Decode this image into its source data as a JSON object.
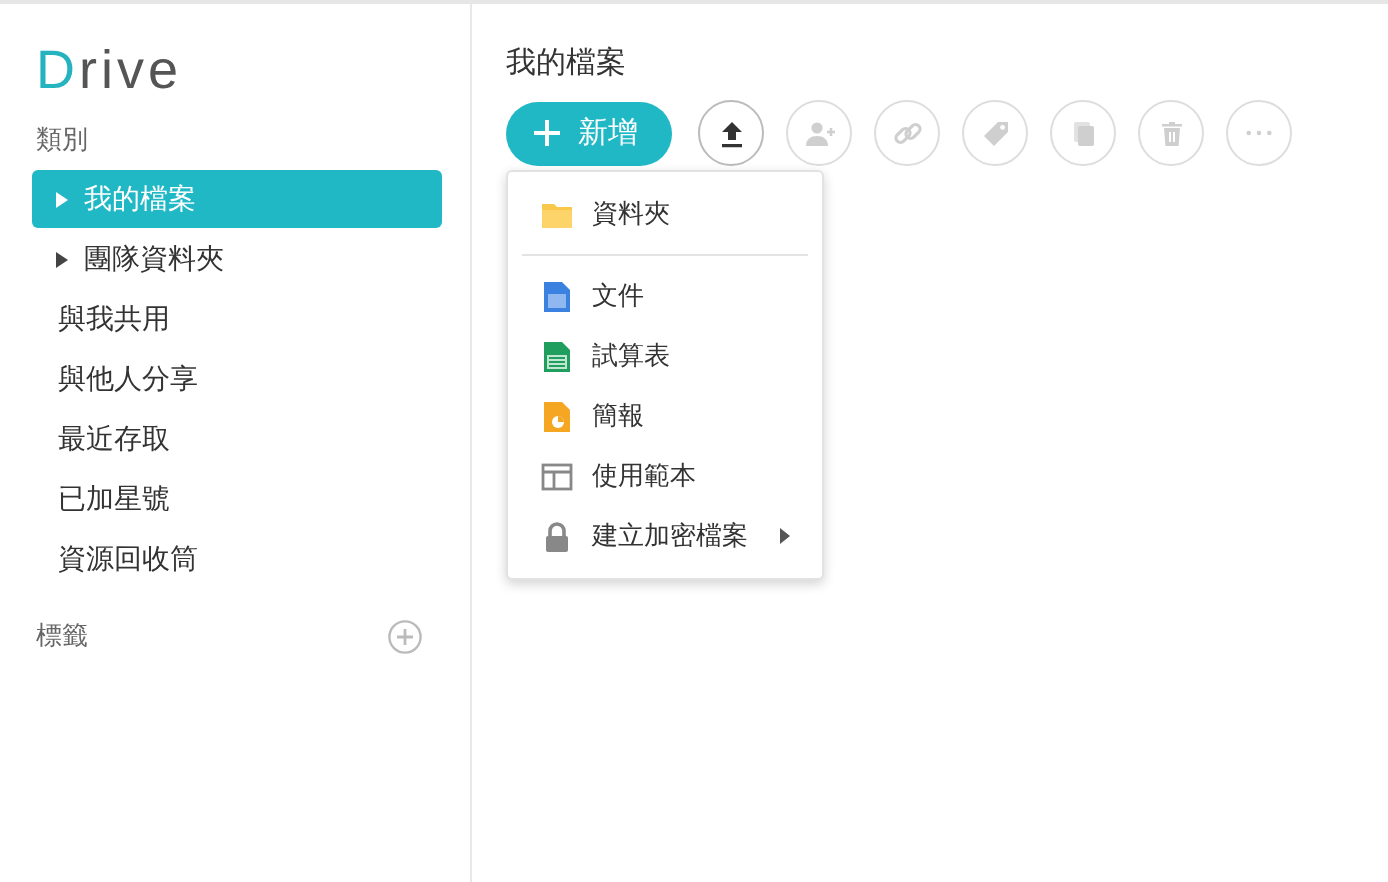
{
  "logo": {
    "text": "Drive"
  },
  "sidebar": {
    "heading": "類別",
    "items": [
      {
        "label": "我的檔案",
        "kind": "expandable",
        "selected": true
      },
      {
        "label": "團隊資料夾",
        "kind": "expandable",
        "selected": false
      },
      {
        "label": "與我共用",
        "kind": "plain",
        "selected": false
      },
      {
        "label": "與他人分享",
        "kind": "plain",
        "selected": false
      },
      {
        "label": "最近存取",
        "kind": "plain",
        "selected": false
      },
      {
        "label": "已加星號",
        "kind": "plain",
        "selected": false
      },
      {
        "label": "資源回收筒",
        "kind": "plain",
        "selected": false
      }
    ],
    "tags_heading": "標籤"
  },
  "main": {
    "title": "我的檔案",
    "new_button": {
      "label": "新增"
    },
    "tools": [
      {
        "kind": "upload",
        "disabled": false
      },
      {
        "kind": "add-person",
        "disabled": true
      },
      {
        "kind": "link",
        "disabled": true
      },
      {
        "kind": "tag",
        "disabled": true
      },
      {
        "kind": "copy",
        "disabled": true
      },
      {
        "kind": "trash",
        "disabled": true
      },
      {
        "kind": "more",
        "disabled": true
      }
    ],
    "menu": {
      "sections": [
        [
          {
            "label": "資料夾",
            "kind": "folder",
            "submenu": false
          }
        ],
        [
          {
            "label": "文件",
            "kind": "document",
            "submenu": false
          },
          {
            "label": "試算表",
            "kind": "spreadsheet",
            "submenu": false
          },
          {
            "label": "簡報",
            "kind": "presentation",
            "submenu": false
          },
          {
            "label": "使用範本",
            "kind": "template",
            "submenu": false
          },
          {
            "label": "建立加密檔案",
            "kind": "lock",
            "submenu": true
          }
        ]
      ]
    }
  }
}
